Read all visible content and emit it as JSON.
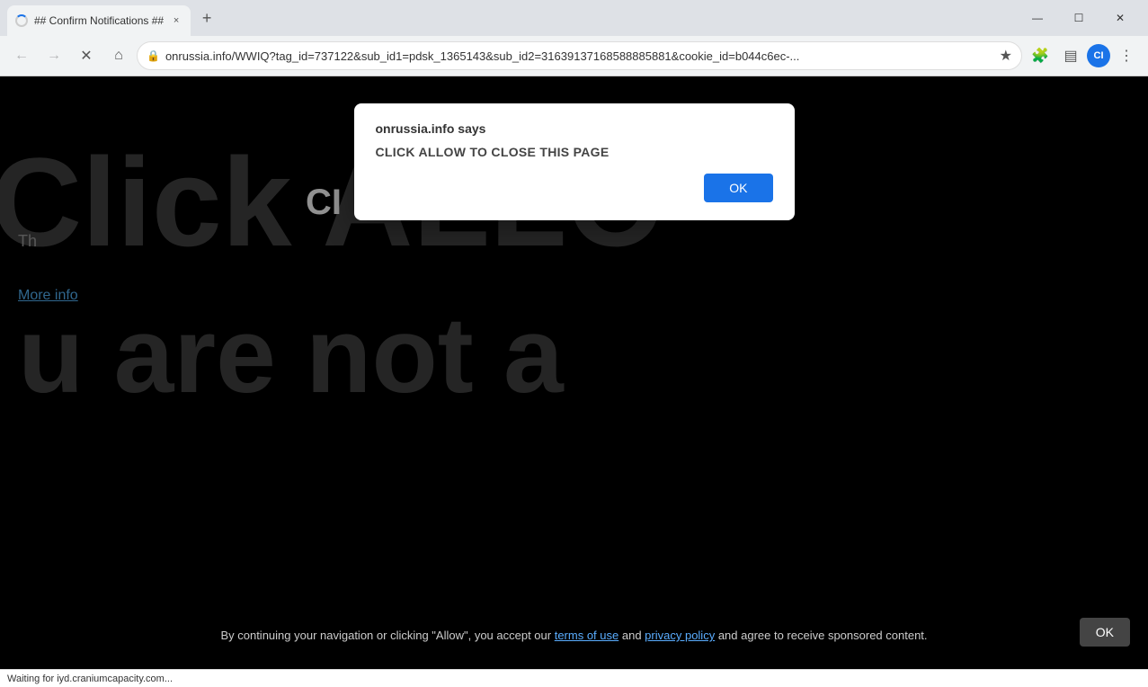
{
  "browser": {
    "tab": {
      "title": "## Confirm Notifications ##",
      "close_label": "×",
      "new_tab_label": "+"
    },
    "window_controls": {
      "minimize": "—",
      "maximize": "☐",
      "close": "✕"
    },
    "nav": {
      "back_label": "←",
      "forward_label": "→",
      "stop_label": "✕",
      "home_label": "⌂"
    },
    "address_bar": {
      "url": "onrussia.info/WWIQ?tag_id=737122&sub_id1=pdsk_1365143&sub_id2=31639137168588885881&cookie_id=b044c6ec-...",
      "lock_icon": "🔒"
    },
    "toolbar": {
      "extensions_icon": "🧩",
      "media_icon": "⬛",
      "profile_initials": "CI",
      "menu_icon": "⋮"
    },
    "status_bar": {
      "loading_text": "Waiting for iyd.craniumcapacity.com..."
    }
  },
  "page": {
    "background_text_line1": "Click ALLO",
    "background_text_line2": "u are not a",
    "background_ci": "CI",
    "background_partial_heading": "Cl",
    "background_th_line1": "Th",
    "background_more_info": "More info"
  },
  "dialog": {
    "site_name": "onrussia.info says",
    "message": "CLICK ALLOW TO CLOSE THIS PAGE",
    "ok_button_label": "OK"
  },
  "consent_bar": {
    "text_before_link1": "By continuing your navigation or clicking \"Allow\", you accept our ",
    "link1": "terms of use",
    "text_between": " and ",
    "link2": "privacy policy",
    "text_after": " and agree to receive sponsored content.",
    "ok_button_label": "OK"
  }
}
